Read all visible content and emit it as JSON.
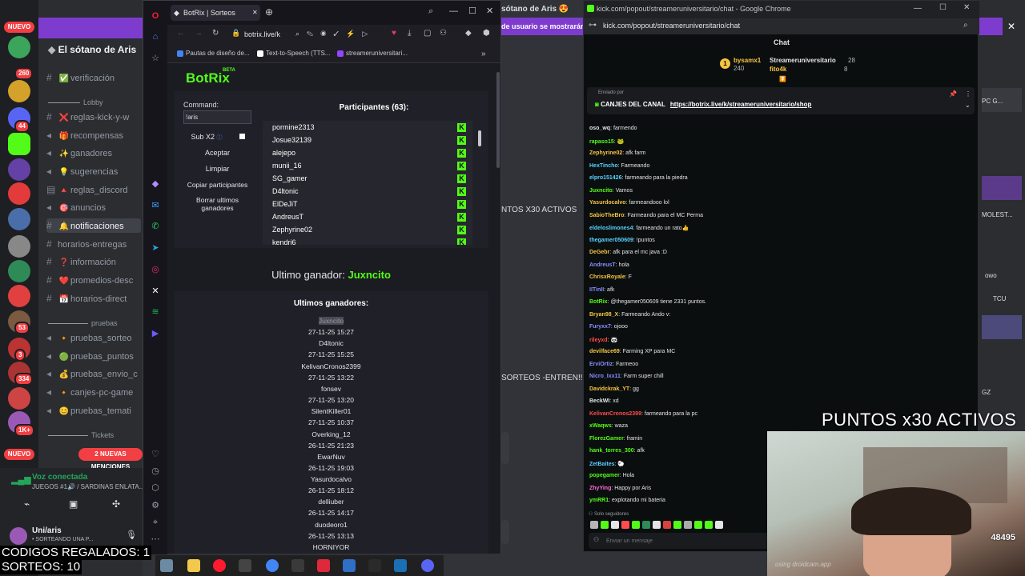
{
  "discord": {
    "server_name": "El sótano de Aris",
    "guild_badge_top": "NUEVO",
    "guild_badge_bottom": "NUEVO",
    "guild_counts": [
      "260",
      "44",
      "53",
      "3",
      "334",
      "1K+"
    ],
    "categories": [
      "Lobby",
      "pruebas",
      "Tickets"
    ],
    "channels": [
      {
        "emoji": "✅",
        "label": "verificación"
      },
      {
        "emoji": "❌",
        "label": "reglas-kick-y-w"
      },
      {
        "emoji": "🎁",
        "label": "recompensas"
      },
      {
        "emoji": "✨",
        "label": "ganadores"
      },
      {
        "emoji": "💡",
        "label": "sugerencias"
      },
      {
        "emoji": "🔺",
        "label": "reglas_discord"
      },
      {
        "emoji": "🎯",
        "label": "anuncios"
      },
      {
        "emoji": "🔔",
        "label": "notificaciones"
      },
      {
        "emoji": "",
        "label": "horarios-entregas"
      },
      {
        "emoji": "❓",
        "label": "información"
      },
      {
        "emoji": "❤️",
        "label": "promedios-desc"
      },
      {
        "emoji": "📅",
        "label": "horarios-direct"
      },
      {
        "emoji": "🔸",
        "label": "pruebas_sorteo"
      },
      {
        "emoji": "🟢",
        "label": "pruebas_puntos"
      },
      {
        "emoji": "💰",
        "label": "pruebas_envio_c"
      },
      {
        "emoji": "",
        "label": "canjes-pc-game"
      },
      {
        "emoji": "😊",
        "label": "pruebas_temati"
      }
    ],
    "new_mentions": "2 NUEVAS MENCIONES",
    "voice_status": "Voz conectada",
    "voice_channel": "JUEGOS #1🔊 / SARDINAS ENLATA...",
    "user_name": "Uni/aris",
    "user_status": "• SORTEANDO UNA P...",
    "background_texts": {
      "header_title": "sótano de Aris 😍",
      "banner": "de usuario se mostrarán",
      "puntos_activos": "NTOS X30 ACTIVOS",
      "sorteos": "SORTEOS -ENTREN!!!!!",
      "right_items": [
        "PC G...",
        "MOLEST...",
        "owo",
        "TCU",
        "GZ"
      ]
    }
  },
  "opera": {
    "tab_title": "BotRix | Sorteos",
    "url": "botrix.live/k",
    "bookmarks": [
      "Pautas de diseño de...",
      "Text-to-Speech (TTS...",
      "streameruniversitari..."
    ]
  },
  "botrix": {
    "logo": "BotRix",
    "beta": "BETA",
    "command_label": "Command:",
    "command_value": "!aris",
    "sub_label": "Sub X2",
    "buttons": [
      "Aceptar",
      "Limpiar",
      "Copiar participantes",
      "Borrar ultimos ganadores"
    ],
    "participants_title": "Participantes (63):",
    "participants": [
      "pormine2313",
      "Josue32139",
      "alejepo",
      "munii_16",
      "SG_gamer",
      "D4ltonic",
      "ElDeJiT",
      "AndreusT",
      "Zephyrine02",
      "kendri6"
    ],
    "last_winner_label": "Ultimo ganador:",
    "last_winner": "Juxncito",
    "winners_title": "Ultimos ganadores:",
    "winners": [
      {
        "name": "Juxncito",
        "date": "27-11-25 15:27"
      },
      {
        "name": "D4ltonic",
        "date": "27-11-25 15:25"
      },
      {
        "name": "KelivanCronos2399",
        "date": "27-11-25 13:22"
      },
      {
        "name": "fonsev",
        "date": "27-11-25 13:20"
      },
      {
        "name": "SilentKiller01",
        "date": "27-11-25 10:37"
      },
      {
        "name": "Overking_12",
        "date": "26-11-25 21:23"
      },
      {
        "name": "EwarNuv",
        "date": "26-11-25 19:03"
      },
      {
        "name": "Yasurdocalvo",
        "date": "26-11-25 18:12"
      },
      {
        "name": "delliuber",
        "date": "26-11-25 14:17"
      },
      {
        "name": "duodeoro1",
        "date": "26-11-25 13:13"
      },
      {
        "name": "HORNIYOR",
        "date": ""
      }
    ]
  },
  "chrome": {
    "window_title": "kick.com/popout/streameruniversitario/chat - Google Chrome",
    "url": "kick.com/popout/streameruniversitario/chat",
    "chat_header": "Chat",
    "leaderboard": [
      {
        "name": "bysamx1",
        "value": "240",
        "color": "#f5c542"
      },
      {
        "name": "Streameruniversitario",
        "value": "28",
        "color": "#e4e4e4"
      },
      {
        "name": "fito4k",
        "value": "8",
        "color": "#f5c542"
      }
    ],
    "pinned_by": "Enviado por",
    "pinned_text": "CANJES DEL CANAL",
    "pinned_link": "https://botrix.live/k/streameruniversitario/shop",
    "messages": [
      {
        "user": "oso_wq",
        "color": "#e4e4e4",
        "text": "farmendo"
      },
      {
        "user": "rapaso15",
        "color": "#53fc18",
        "text": "🐸"
      },
      {
        "user": "Zephyrine02",
        "color": "#f5c542",
        "text": "afk farm"
      },
      {
        "user": "HexTincho",
        "color": "#5ad1ff",
        "text": "Farmeando"
      },
      {
        "user": "elpro151426",
        "color": "#5ad1ff",
        "text": "farmeando para la piedra"
      },
      {
        "user": "Juxncito",
        "color": "#53fc18",
        "text": "Vamos"
      },
      {
        "user": "Yasurdocalvo",
        "color": "#f5c542",
        "text": "farmeandooo lol"
      },
      {
        "user": "SabioTheBro",
        "color": "#f5c542",
        "text": "Farmeando para el MC Perma"
      },
      {
        "user": "eldeloslimones4",
        "color": "#5ad1ff",
        "text": "farmeando un rato👍"
      },
      {
        "user": "thegamer050609",
        "color": "#5ad1ff",
        "text": "!puntos"
      },
      {
        "user": "DeGebr",
        "color": "#f5c542",
        "text": "afk para el mc java :D"
      },
      {
        "user": "AndreusT",
        "color": "#8a8cff",
        "text": "hola"
      },
      {
        "user": "ChrisxRoyale",
        "color": "#f5c542",
        "text": "F"
      },
      {
        "user": "IITinII",
        "color": "#8a8cff",
        "text": "afk"
      },
      {
        "user": "BotRix",
        "color": "#53fc18",
        "text": "@thegamer050609 tiene 2331 puntos."
      },
      {
        "user": "Bryan98_X",
        "color": "#f5c542",
        "text": "Farmeando Ando v:"
      },
      {
        "user": "Furyxx7",
        "color": "#8a8cff",
        "text": "ojooo"
      },
      {
        "user": "rileyxd",
        "color": "#ff4d4d",
        "text": "🐼"
      },
      {
        "user": "devilface69",
        "color": "#f5c542",
        "text": "Farming XP para MC"
      },
      {
        "user": "ErviOrtiz",
        "color": "#8a8cff",
        "text": "Farmeoo"
      },
      {
        "user": "Nicro_Ixx11",
        "color": "#8a8cff",
        "text": "Farm super chill"
      },
      {
        "user": "Davidckrak_YT",
        "color": "#f5c542",
        "text": "gg"
      },
      {
        "user": "BeckWI",
        "color": "#e4e4e4",
        "text": "xd"
      },
      {
        "user": "KelivanCronos2399",
        "color": "#ff4d4d",
        "text": "farmeando para la pc"
      },
      {
        "user": "xWaqws",
        "color": "#53fc18",
        "text": "waza"
      },
      {
        "user": "FlorezGamer",
        "color": "#53fc18",
        "text": "framin"
      },
      {
        "user": "hank_torres_300",
        "color": "#53fc18",
        "text": "afk"
      },
      {
        "user": "ZetBaites",
        "color": "#5ad1ff",
        "text": "🐑"
      },
      {
        "user": "popegamer",
        "color": "#53fc18",
        "text": "Hola"
      },
      {
        "user": "ZhyYing",
        "color": "#ff6ad5",
        "text": "Happy por Aris"
      },
      {
        "user": "ymRR1",
        "color": "#53fc18",
        "text": "explotando mi bateria"
      }
    ],
    "followers_only": "Solo seguidores",
    "input_placeholder": "Enviar un mensaje"
  },
  "overlays": {
    "puntos": "PUNTOS x30 ACTIVOS",
    "codes": "CODIGOS REGALADOS: 1",
    "sorteos": "SORTEOS: 10",
    "webcam_count": "48495",
    "webcam_watermark": "using droidcam.app"
  },
  "colors": {
    "kick_green": "#53fc18",
    "discord_red": "#f23f43",
    "discord_bg": "#313338"
  }
}
